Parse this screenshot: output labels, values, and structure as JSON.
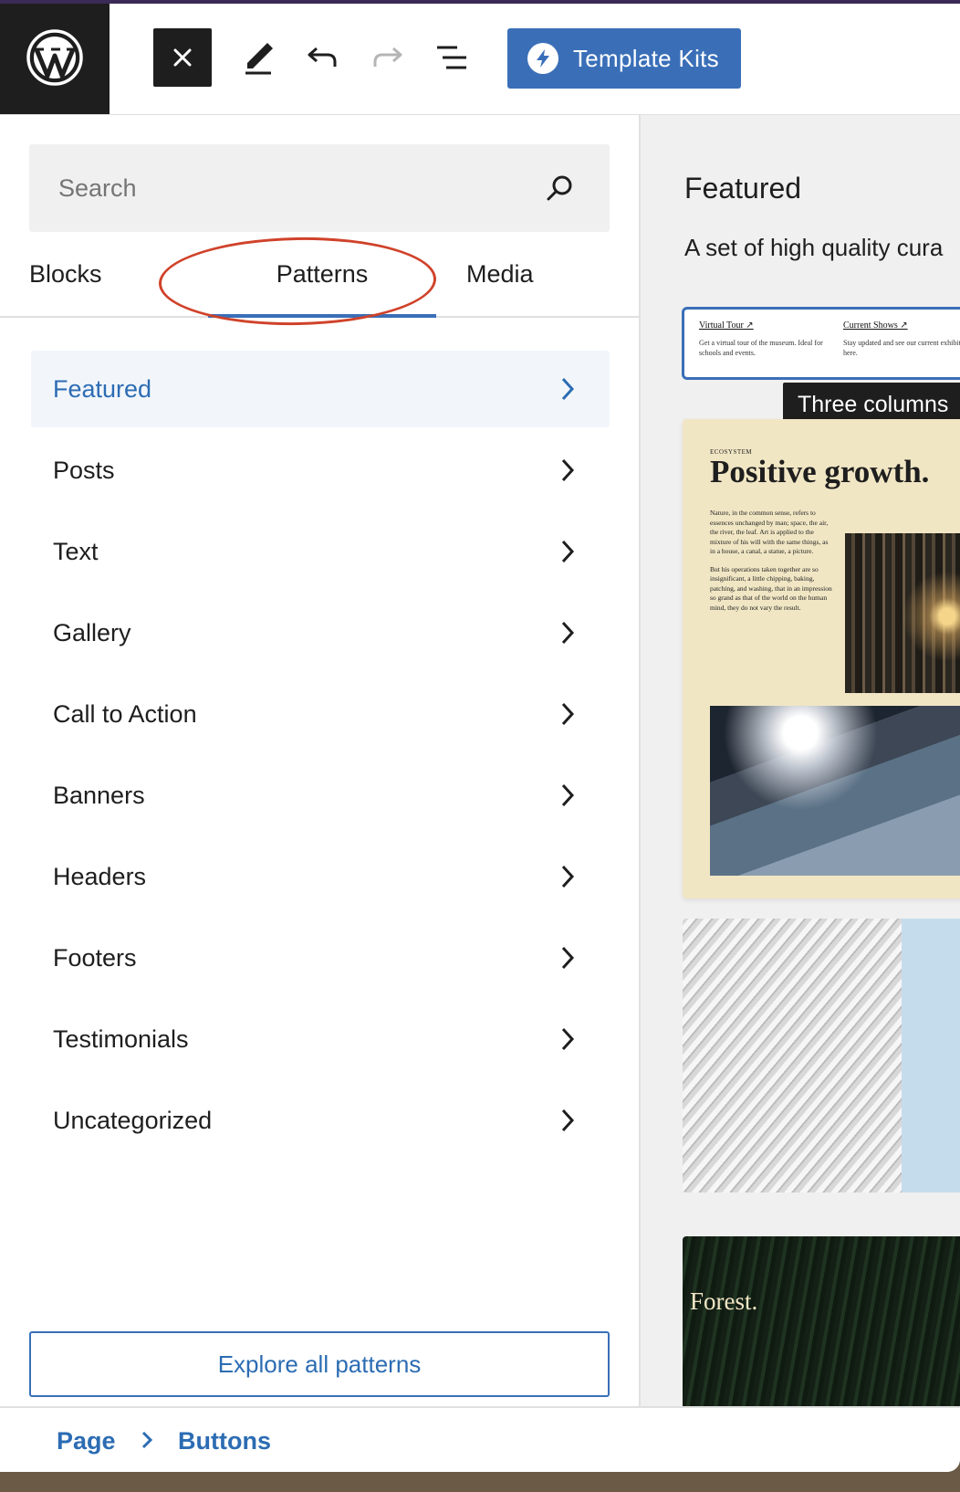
{
  "toolbar": {
    "template_kits_label": "Template Kits"
  },
  "search": {
    "placeholder": "Search"
  },
  "tabs": [
    {
      "label": "Blocks"
    },
    {
      "label": "Patterns"
    },
    {
      "label": "Media"
    }
  ],
  "categories": [
    {
      "label": "Featured"
    },
    {
      "label": "Posts"
    },
    {
      "label": "Text"
    },
    {
      "label": "Gallery"
    },
    {
      "label": "Call to Action"
    },
    {
      "label": "Banners"
    },
    {
      "label": "Headers"
    },
    {
      "label": "Footers"
    },
    {
      "label": "Testimonials"
    },
    {
      "label": "Uncategorized"
    }
  ],
  "explore_label": "Explore all patterns",
  "preview": {
    "title": "Featured",
    "description": "A set of high quality cura",
    "tooltip": "Three columns",
    "card1": {
      "col1_heading": "Virtual Tour ↗",
      "col1_text": "Get a virtual tour of the museum. Ideal for schools and events.",
      "col2_heading": "Current Shows ↗",
      "col2_text": "Stay updated and see our current exhibitions here."
    },
    "card2": {
      "eyebrow": "ECOSYSTEM",
      "title": "Positive growth.",
      "para1": "Nature, in the common sense, refers to essences unchanged by man; space, the air, the river, the leaf. Art is applied to the mixture of his will with the same things, as in a house, a canal, a statue, a picture.",
      "para2": "But his operations taken together are so insignificant, a little chipping, baking, patching, and washing, that in an impression so grand as that of the world on the human mind, they do not vary the result."
    },
    "card4_title": "Forest."
  },
  "breadcrumb": {
    "page": "Page",
    "separator": "›",
    "current": "Buttons"
  },
  "colors": {
    "accent": "#3a6fb8",
    "active_text": "#2c6cb3",
    "annotation": "#d0422a",
    "dark": "#1e1e1e"
  },
  "icons": [
    "wordpress-logo-icon",
    "close-icon",
    "pencil-icon",
    "undo-icon",
    "redo-icon",
    "document-overview-icon",
    "template-kits-icon",
    "search-icon",
    "chevron-right-icon"
  ]
}
